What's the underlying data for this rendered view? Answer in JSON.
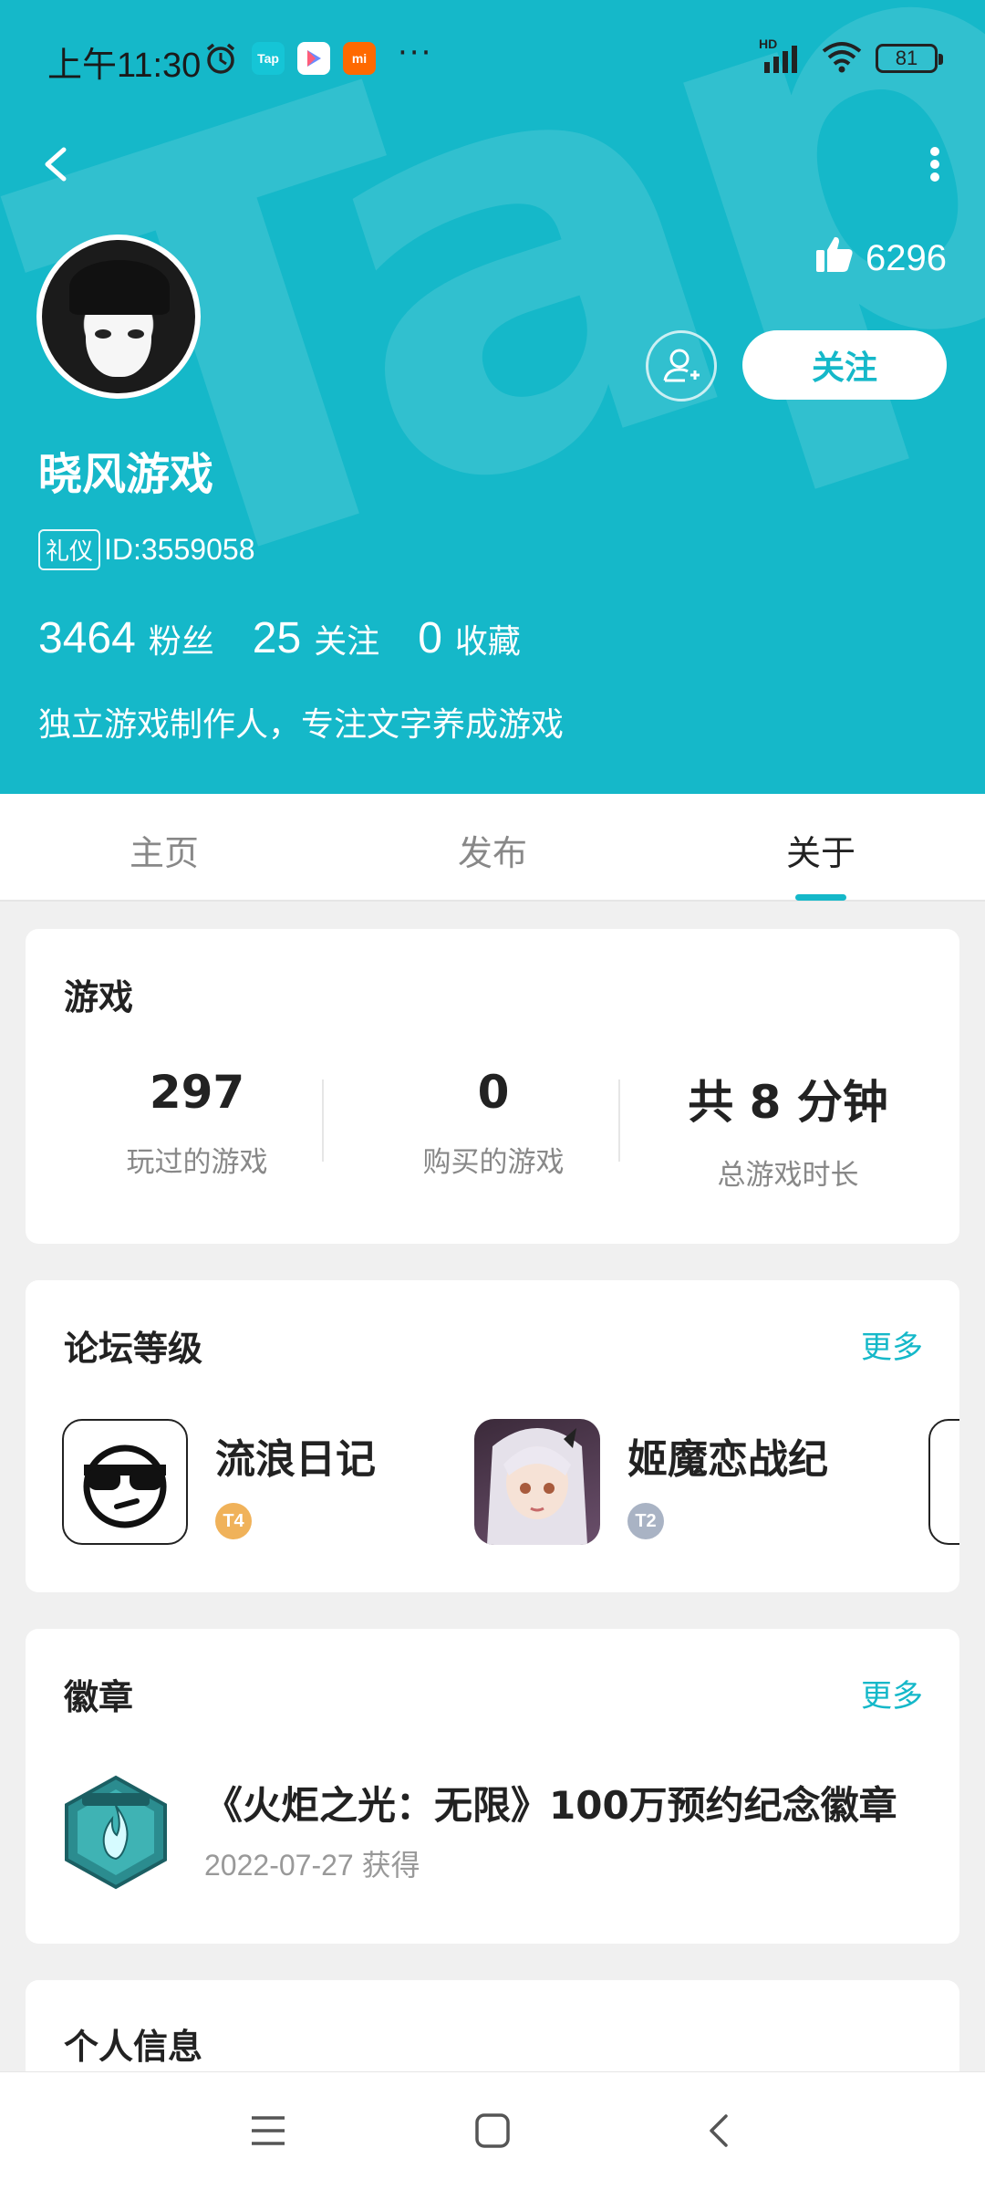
{
  "status_bar": {
    "time": "上午11:30",
    "app_icon_labels": [
      "Tap",
      "",
      "mi"
    ],
    "more": "···",
    "network": "HD",
    "battery": "81"
  },
  "header": {
    "likes": "6296",
    "follow_label": "关注",
    "username": "晓风游戏",
    "etiquette_tag": "礼仪",
    "user_id": "ID:3559058",
    "stats": [
      {
        "value": "3464",
        "label": "粉丝"
      },
      {
        "value": "25",
        "label": "关注"
      },
      {
        "value": "0",
        "label": "收藏"
      }
    ],
    "bio": "独立游戏制作人，专注文字养成游戏"
  },
  "tabs": [
    {
      "label": "主页",
      "active": false
    },
    {
      "label": "发布",
      "active": false
    },
    {
      "label": "关于",
      "active": true
    }
  ],
  "games_card": {
    "title": "游戏",
    "stats": [
      {
        "value": "297",
        "label": "玩过的游戏"
      },
      {
        "value": "0",
        "label": "购买的游戏"
      },
      {
        "value": "共 8 分钟",
        "label": "总游戏时长"
      }
    ]
  },
  "forum_card": {
    "title": "论坛等级",
    "more": "更多",
    "items": [
      {
        "name": "流浪日记",
        "level": "T4",
        "level_color": "#f0b25a"
      },
      {
        "name": "姬魔恋战纪",
        "level": "T2",
        "level_color": "#a9b3c4"
      }
    ]
  },
  "badge_card": {
    "title": "徽章",
    "more": "更多",
    "badge_title": "《火炬之光：无限》100万预约纪念徽章",
    "badge_date": "2022-07-27 获得"
  },
  "info_card": {
    "title": "个人信息"
  },
  "colors": {
    "brand": "#15b8c9",
    "background": "#f0f0f0"
  }
}
